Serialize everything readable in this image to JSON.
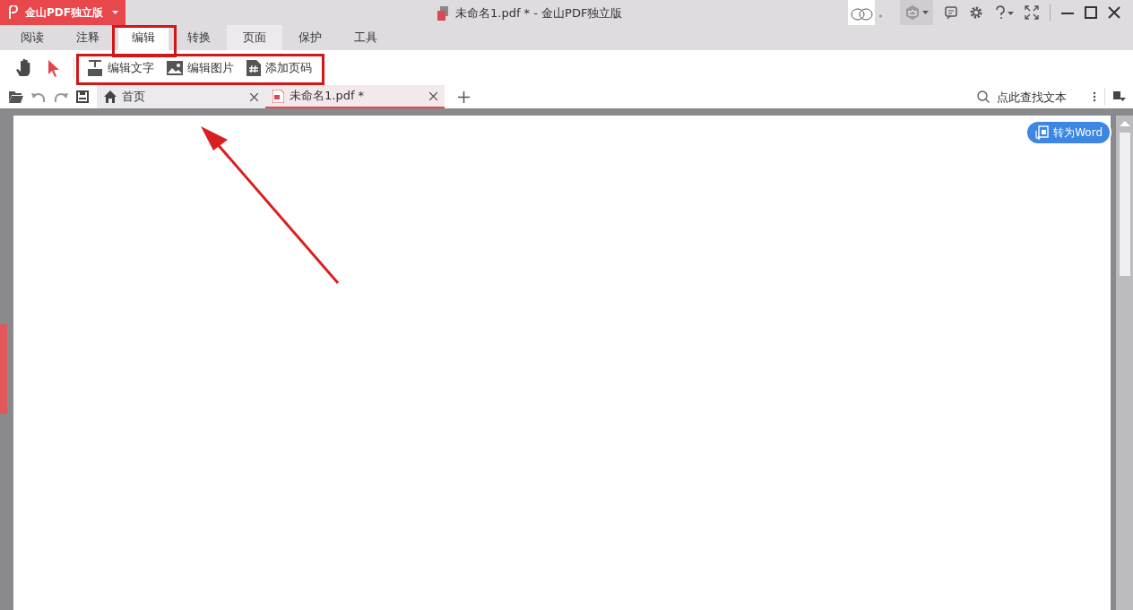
{
  "app_menu": {
    "label": "金山PDF独立版"
  },
  "window": {
    "title": "未命名1.pdf * - 金山PDF独立版",
    "status_mark": "。"
  },
  "ribbon_tabs": [
    {
      "label": "阅读",
      "selected": false,
      "hovered": false,
      "annotated": false
    },
    {
      "label": "注释",
      "selected": false,
      "hovered": false,
      "annotated": false
    },
    {
      "label": "编辑",
      "selected": true,
      "hovered": false,
      "annotated": true
    },
    {
      "label": "转换",
      "selected": false,
      "hovered": false,
      "annotated": false
    },
    {
      "label": "页面",
      "selected": false,
      "hovered": true,
      "annotated": false
    },
    {
      "label": "保护",
      "selected": false,
      "hovered": false,
      "annotated": false
    },
    {
      "label": "工具",
      "selected": false,
      "hovered": false,
      "annotated": false
    }
  ],
  "ribbon": {
    "annotated": true,
    "tools": [
      {
        "label": "编辑文字",
        "kind": "vip"
      },
      {
        "label": "编辑图片",
        "kind": "image"
      },
      {
        "label": "添加页码",
        "kind": "pagenum"
      }
    ]
  },
  "doc_tabs": [
    {
      "label": "首页",
      "kind": "home",
      "selected": false
    },
    {
      "label": "未命名1.pdf *",
      "kind": "pdf",
      "selected": true
    }
  ],
  "search": {
    "placeholder": "点此查找文本"
  },
  "convert_button": {
    "label": "转为Word"
  },
  "annotation_arrow": true
}
